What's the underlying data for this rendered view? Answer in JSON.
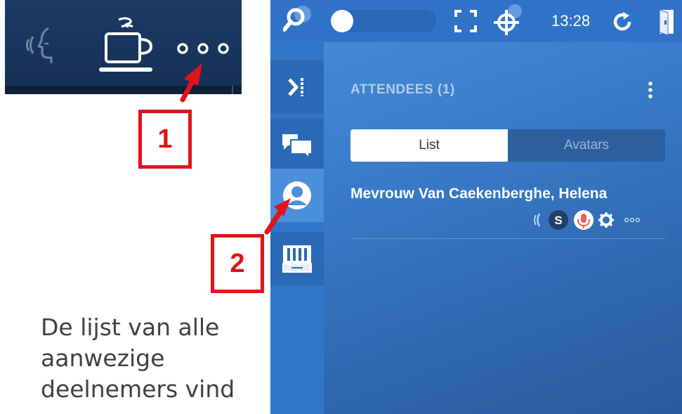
{
  "annotations": {
    "callout_1": "1",
    "callout_2": "2"
  },
  "caption": {
    "line1": "De lijst van alle",
    "line2": "aanwezige",
    "line3": "deelnemers vind"
  },
  "topbar": {
    "time": "13:28"
  },
  "panel": {
    "section_title": "ATTENDEES (1)",
    "view_toggle": {
      "list_label": "List",
      "avatars_label": "Avatars",
      "selected": "List"
    }
  },
  "attendees": [
    {
      "name": "Mevrouw Van Caekenberghe, Helena",
      "badge_letter": "S"
    }
  ],
  "colors": {
    "annotation_red": "#e0131b",
    "panel_blue": "#3a7dcc",
    "topbar_blue": "#2f72c7",
    "mic_active": "#e8605a"
  },
  "icons": [
    "speech-icon",
    "coffee-icon",
    "more-dots-icon",
    "search-icon",
    "fullscreen-icon",
    "target-icon",
    "refresh-icon",
    "exit-icon",
    "collapse-sidebar-icon",
    "chat-icon",
    "attendees-icon",
    "whiteboard-icon",
    "kebab-menu-icon",
    "speaking-icon",
    "microphone-icon",
    "settings-icon"
  ]
}
